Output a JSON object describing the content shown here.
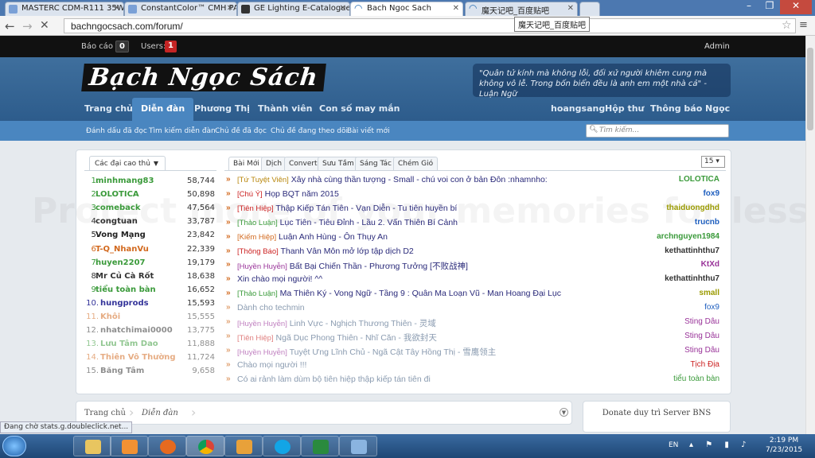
{
  "browser": {
    "tabs": [
      {
        "title": "MASTERC CDM-R111 35W",
        "active": false
      },
      {
        "title": "ConstantColor™ CMH PAR",
        "active": false
      },
      {
        "title": "GE Lighting E-Catalogue |",
        "active": false
      },
      {
        "title": "Bach Ngoc Sach",
        "active": true
      },
      {
        "title": "魔天记吧_百度贴吧",
        "active": false
      }
    ],
    "url": "bachngocsach.com/forum/",
    "tooltip": "魔天记吧_百度贴吧"
  },
  "adminbar": {
    "reports_label": "Báo cáo :",
    "reports_count": "0",
    "users_label": "Users:",
    "users_count": "1",
    "admin_label": "Admin"
  },
  "header": {
    "logo_text": "Bạch Ngọc Sách",
    "quote": "\"Quân tử kính mà không lỗi, đối xử người khiêm cung mà không vô lễ. Trong bốn biển đều là anh em một nhà cả\" - Luận Ngữ",
    "nav_left": [
      "Trang chủ",
      "Diễn đàn",
      "Phương Thị",
      "Thành viên",
      "Con số may mắn"
    ],
    "nav_right": [
      "hoangsang",
      "Hộp thư",
      "Thông báo",
      "Ngọc"
    ]
  },
  "subnav": {
    "items": [
      "Đánh dấu đã đọc",
      "Tìm kiếm diễn đàn",
      "Chủ đề đã đọc",
      "Chủ đề đang theo dõi",
      "Bài viết mới"
    ],
    "search_placeholder": "Tìm kiếm..."
  },
  "top_users": {
    "dropdown_label": "Các đại cao thủ",
    "list": [
      {
        "rank": "1.",
        "name": "minhmang83",
        "count": "58,744",
        "color": "#3a9a3a"
      },
      {
        "rank": "2.",
        "name": "LOLOTICA",
        "count": "50,898",
        "color": "#3a9a3a"
      },
      {
        "rank": "3.",
        "name": "comeback",
        "count": "47,564",
        "color": "#3a9a3a"
      },
      {
        "rank": "4.",
        "name": "congtuan",
        "count": "33,787",
        "color": "#333333"
      },
      {
        "rank": "5.",
        "name": "Vong Mạng",
        "count": "23,842",
        "color": "#222222"
      },
      {
        "rank": "6.",
        "name": "T-Q_NhanVu",
        "count": "22,339",
        "color": "#d2691e"
      },
      {
        "rank": "7.",
        "name": "huyen2207",
        "count": "19,179",
        "color": "#3a9a3a"
      },
      {
        "rank": "8.",
        "name": "Mr Củ Cà Rốt",
        "count": "18,638",
        "color": "#333333"
      },
      {
        "rank": "9.",
        "name": "tiểu toàn bàn",
        "count": "16,652",
        "color": "#3a9a3a"
      },
      {
        "rank": "10.",
        "name": "hungprods",
        "count": "15,593",
        "color": "#333399"
      },
      {
        "rank": "11.",
        "name": "Khôi",
        "count": "15,555",
        "color": "#d2691e"
      },
      {
        "rank": "12.",
        "name": "nhatchimai0000",
        "count": "13,775",
        "color": "#333333"
      },
      {
        "rank": "13.",
        "name": "Lưu Tâm Dao",
        "count": "11,888",
        "color": "#3a9a3a"
      },
      {
        "rank": "14.",
        "name": "Thiên Vô Thường",
        "count": "11,724",
        "color": "#d2691e"
      },
      {
        "rank": "15.",
        "name": "Băng Tâm",
        "count": "9,658",
        "color": "#333333"
      }
    ]
  },
  "feed": {
    "tabs": [
      "Bài Mới",
      "Dịch",
      "Convert",
      "Sưu Tầm",
      "Sáng Tác",
      "Chém Gió"
    ],
    "per_page": "15 ▾",
    "rows": [
      {
        "prefix": "[Tứ Tuyệt Viên]",
        "prefix_color": "#b8860b",
        "title": "Xây nhà cùng thần tượng - Small - chú voi con ở bản Đôn :nhamnho:",
        "title_color": "#2a2a7a",
        "author": "LOLOTICA",
        "author_color": "#3a9a3a"
      },
      {
        "prefix": "[Chú Ý]",
        "prefix_color": "#cc2222",
        "title": "Họp BQT năm 2015",
        "title_color": "#2a2a7a",
        "author": "fox9",
        "author_color": "#1f5fbf"
      },
      {
        "prefix": "[Tiên Hiệp]",
        "prefix_color": "#cc2222",
        "title": "Thập Kiếp Tán Tiên - Vạn Diễn - Tu tiên huyền bí",
        "title_color": "#2a2a7a",
        "author": "thaiduongdhd",
        "author_color": "#9a9a00"
      },
      {
        "prefix": "[Thảo Luận]",
        "prefix_color": "#3a9a3a",
        "title": "Lục Tiên - Tiêu Đỉnh - Lầu 2. Vấn Thiên Bí Cảnh",
        "title_color": "#2a2a7a",
        "author": "trucnb",
        "author_color": "#1f5fbf"
      },
      {
        "prefix": "[Kiếm Hiệp]",
        "prefix_color": "#d2691e",
        "title": "Luận Anh Hùng - Ôn Thụy An",
        "title_color": "#2a2a7a",
        "author": "archnguyen1984",
        "author_color": "#3a9a3a"
      },
      {
        "prefix": "[Thông Báo]",
        "prefix_color": "#cc2222",
        "title": "Thanh Vân Môn mở lớp tập dịch D2",
        "title_color": "#2a2a7a",
        "author": "kethattinhthu7",
        "author_color": "#333333"
      },
      {
        "prefix": "[Huyền Huyễn]",
        "prefix_color": "#993399",
        "title": "Bất Bại Chiến Thần - Phương Tưởng [不败战神]",
        "title_color": "#2a2a7a",
        "author": "KtXd",
        "author_color": "#993399"
      },
      {
        "prefix": "",
        "prefix_color": "#333333",
        "title": "Xin chào mọi người! ^^",
        "title_color": "#2a2a7a",
        "author": "kethattinhthu7",
        "author_color": "#333333"
      },
      {
        "prefix": "[Thảo Luận]",
        "prefix_color": "#3a9a3a",
        "title": "Ma Thiên Ký - Vong Ngữ - Tầng 9 : Quân Ma Loạn Vũ - Man Hoang Đại Lục",
        "title_color": "#2a2a7a",
        "author": "small",
        "author_color": "#9a9a00"
      },
      {
        "prefix": "",
        "prefix_color": "#333333",
        "title": "Dành cho techmin",
        "title_color": "#8a9bb0",
        "author": "fox9",
        "author_color": "#1f5fbf"
      },
      {
        "prefix": "[Huyền Huyễn]",
        "prefix_color": "#c080c0",
        "title": "Linh Vực - Nghịch Thương Thiên - 灵域",
        "title_color": "#8a9bb0",
        "author": "Sting Dâu",
        "author_color": "#993399"
      },
      {
        "prefix": "[Tiên Hiệp]",
        "prefix_color": "#e08080",
        "title": "Ngã Dục Phong Thiên - Nhĩ Căn - 我欲封天",
        "title_color": "#8a9bb0",
        "author": "Sting Dâu",
        "author_color": "#993399"
      },
      {
        "prefix": "[Huyền Huyễn]",
        "prefix_color": "#c080c0",
        "title": "Tuyệt Ưng Lĩnh Chủ - Ngã Cật Tây Hồng Thị - 雪鹰领主",
        "title_color": "#8a9bb0",
        "author": "Sting Dâu",
        "author_color": "#993399"
      },
      {
        "prefix": "",
        "prefix_color": "#333333",
        "title": "Chào mọi người !!!",
        "title_color": "#8a9bb0",
        "author": "Tịch Địa",
        "author_color": "#cc2222"
      },
      {
        "prefix": "",
        "prefix_color": "#333333",
        "title": "Có ai rảnh làm dùm bộ tiên hiệp thập kiếp tán tiên đi",
        "title_color": "#8a9bb0",
        "author": "tiểu toàn bàn",
        "author_color": "#3a9a3a"
      }
    ]
  },
  "breadcrumb": [
    "Trang chủ",
    "Diễn đàn"
  ],
  "donate_title": "Donate duy trì Server BNS",
  "status_text": "Đang chờ stats.g.doubleclick.net...",
  "watermark": "Protect more of your memories for less!",
  "taskbar": {
    "lang": "EN",
    "time": "2:19 PM",
    "date": "7/23/2015"
  }
}
